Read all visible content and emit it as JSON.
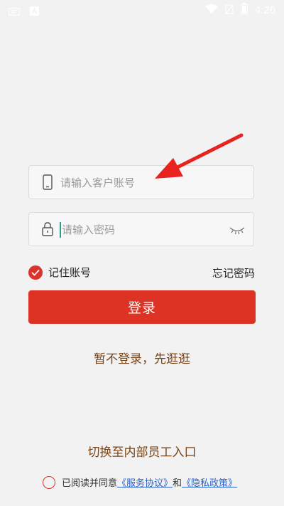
{
  "status_bar": {
    "time": "4:26",
    "icons": [
      "message-icon",
      "notification-a-icon",
      "wifi-icon",
      "no-sim-icon",
      "battery-icon"
    ]
  },
  "login": {
    "account_placeholder": "请输入客户账号",
    "password_placeholder": "请输入密码",
    "remember_label": "记住账号",
    "remember_checked": true,
    "forgot_label": "忘记密码",
    "submit_label": "登录",
    "guest_label": "暂不登录，先逛逛",
    "staff_label": "切换至内部员工入口"
  },
  "agreement": {
    "prefix": "已阅读并同意",
    "service_link": "《服务协议》",
    "conjunction": "和",
    "privacy_link": "《隐私政策》",
    "checked": false
  },
  "colors": {
    "background": "#f2f2f2",
    "primary": "#dd3325",
    "link_brown": "#7a4416",
    "link_blue": "#2a62c9",
    "annotation": "#e8231f"
  }
}
